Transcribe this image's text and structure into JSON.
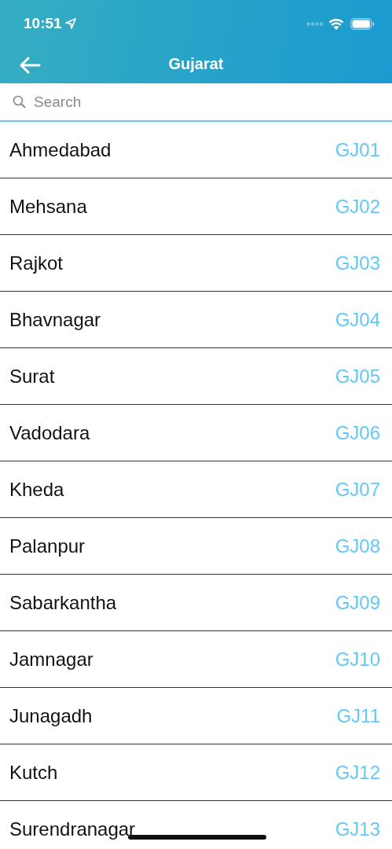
{
  "status_bar": {
    "time": "10:51"
  },
  "nav_bar": {
    "title": "Gujarat"
  },
  "search": {
    "placeholder": "Search"
  },
  "districts": [
    {
      "name": "Ahmedabad",
      "code": "GJ01"
    },
    {
      "name": "Mehsana",
      "code": "GJ02"
    },
    {
      "name": "Rajkot",
      "code": "GJ03"
    },
    {
      "name": "Bhavnagar",
      "code": "GJ04"
    },
    {
      "name": "Surat",
      "code": "GJ05"
    },
    {
      "name": "Vadodara",
      "code": "GJ06"
    },
    {
      "name": "Kheda",
      "code": "GJ07"
    },
    {
      "name": "Palanpur",
      "code": "GJ08"
    },
    {
      "name": "Sabarkantha",
      "code": "GJ09"
    },
    {
      "name": "Jamnagar",
      "code": "GJ10"
    },
    {
      "name": "Junagadh",
      "code": "GJ11"
    },
    {
      "name": "Kutch",
      "code": "GJ12"
    },
    {
      "name": "Surendranagar",
      "code": "GJ13"
    }
  ]
}
